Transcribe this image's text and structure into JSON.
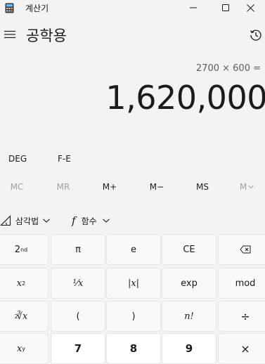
{
  "window": {
    "app_title": "계산기",
    "icon": "calculator-icon",
    "controls": [
      "minimize-icon",
      "maximize-icon",
      "close-icon"
    ]
  },
  "header": {
    "mode_title": "공학용",
    "menu_icon": "hamburger-menu-icon",
    "history_icon": "history-icon"
  },
  "display": {
    "expression": "2700 × 600 =",
    "result": "1,620,000"
  },
  "toggles": {
    "angle": "DEG",
    "fe": "F-E"
  },
  "memory": {
    "mc": "MC",
    "mr": "MR",
    "m_plus": "M+",
    "m_minus": "M−",
    "ms": "MS",
    "m_view": "M"
  },
  "functions": {
    "trig_label": "삼각법",
    "func_label": "함수"
  },
  "keypad": {
    "row1": {
      "second_base": "2",
      "second_sup": "nd",
      "pi": "π",
      "e": "e",
      "ce": "CE",
      "backspace": "backspace-icon"
    },
    "row2": {
      "square_base": "x",
      "square_sup": "2",
      "reciprocal": "⅟x",
      "abs": "|x|",
      "exp": "exp",
      "mod": "mod"
    },
    "row3": {
      "root": "∛x",
      "root_index": "2",
      "open_paren": "(",
      "close_paren": ")",
      "factorial": "n!",
      "divide": "÷"
    },
    "row4": {
      "power_base": "x",
      "power_sup": "y",
      "seven": "7",
      "eight": "8",
      "nine": "9",
      "multiply": "×"
    }
  }
}
